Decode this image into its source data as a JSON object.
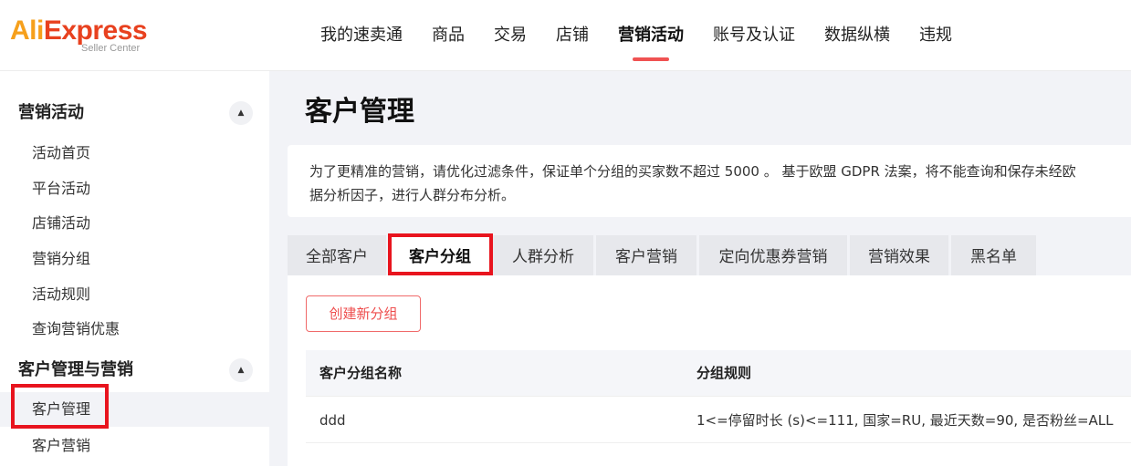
{
  "logo": {
    "brand_a": "Ali",
    "brand_b": "Express",
    "subtitle": "Seller Center"
  },
  "topnav": [
    "我的速卖通",
    "商品",
    "交易",
    "店铺",
    "营销活动",
    "账号及认证",
    "数据纵横",
    "违规"
  ],
  "topnav_active": "营销活动",
  "sidebar": {
    "group1": {
      "title": "营销活动",
      "collapse_icon": "caret-up-icon",
      "items": [
        "活动首页",
        "平台活动",
        "店铺活动",
        "营销分组",
        "活动规则",
        "查询营销优惠"
      ]
    },
    "group2": {
      "title": "客户管理与营销",
      "collapse_icon": "caret-up-icon",
      "items": [
        "客户管理",
        "客户营销"
      ],
      "active": "客户管理"
    }
  },
  "page_title": "客户管理",
  "notice": {
    "line1": "为了更精准的营销，请优化过滤条件，保证单个分组的买家数不超过 5000 。 基于欧盟 GDPR 法案，将不能查询和保存未经欧",
    "line2": "据分析因子，进行人群分布分析。"
  },
  "tabs": [
    "全部客户",
    "客户分组",
    "人群分析",
    "客户营销",
    "定向优惠券营销",
    "营销效果",
    "黑名单"
  ],
  "tabs_active": "客户分组",
  "create_button": "创建新分组",
  "table": {
    "headers": [
      "客户分组名称",
      "分组规则"
    ],
    "rows": [
      {
        "name": "ddd",
        "rule": "1<=停留时长 (s)<=111, 国家=RU, 最近天数=90, 是否粉丝=ALL"
      }
    ]
  },
  "colors": {
    "accent": "#f05252",
    "highlight_box": "#e8141e",
    "brand_orange": "#f6a01c",
    "brand_red": "#e8411f"
  }
}
